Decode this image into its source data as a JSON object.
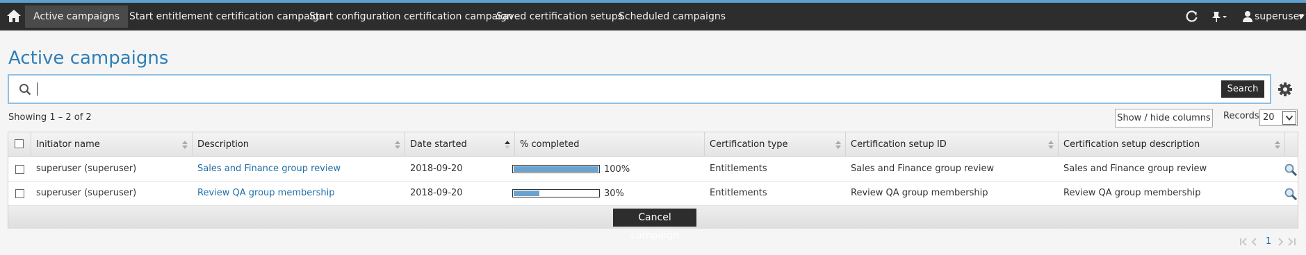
{
  "nav": {
    "items": [
      "Active campaigns",
      "Start entitlement certification campaign",
      "Start configuration certification campaign",
      "Saved certification setups",
      "Scheduled campaigns"
    ],
    "user": "superuser"
  },
  "page": {
    "title": "Active campaigns",
    "search_button": "Search",
    "showing": "Showing 1 – 2 of 2",
    "show_hide": "Show / hide columns",
    "records_label": "Records",
    "records_value": "20",
    "cancel_button": "Cancel campaign",
    "page_number": "1"
  },
  "table": {
    "columns": [
      "Initiator name",
      "Description",
      "Date started",
      "% completed",
      "Certification type",
      "Certification setup ID",
      "Certification setup description"
    ],
    "rows": [
      {
        "initiator": "superuser (superuser)",
        "description": "Sales and Finance group review",
        "date": "2018-09-20",
        "percent": 100,
        "percent_label": "100%",
        "type": "Entitlements",
        "setup_id": "Sales and Finance group review",
        "setup_desc": "Sales and Finance group review"
      },
      {
        "initiator": "superuser (superuser)",
        "description": "Review QA group membership",
        "date": "2018-09-20",
        "percent": 30,
        "percent_label": "30%",
        "type": "Entitlements",
        "setup_id": "Review QA group membership",
        "setup_desc": "Review QA group membership"
      }
    ]
  },
  "colors": {
    "accent": "#2f7fb6",
    "link": "#1f6ea8",
    "navbar": "#2d2d2d",
    "progress": "#6aa3cf"
  },
  "icons": [
    "home-icon",
    "refresh-icon",
    "pin-icon",
    "user-icon",
    "search-icon",
    "gear-icon",
    "magnify-icon",
    "pager-first-icon",
    "pager-prev-icon",
    "pager-next-icon",
    "pager-last-icon"
  ]
}
